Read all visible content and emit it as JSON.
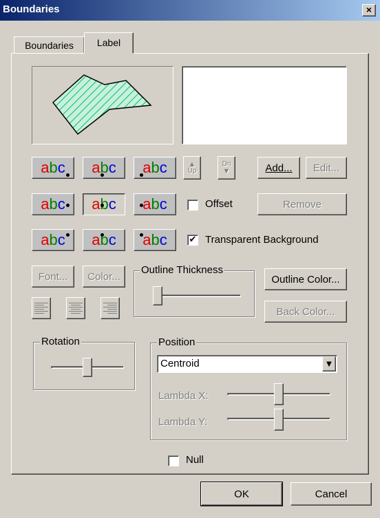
{
  "window": {
    "title": "Boundaries",
    "close_glyph": "×"
  },
  "tabs": [
    {
      "label": "Boundaries",
      "active": false
    },
    {
      "label": "Label",
      "active": true
    }
  ],
  "label_sample_text": "abc",
  "placement_buttons": [
    {
      "dot": "bottom-right",
      "pressed": false
    },
    {
      "dot": "bottom-center",
      "pressed": false
    },
    {
      "dot": "bottom-left",
      "pressed": false
    },
    {
      "dot": "right",
      "pressed": false
    },
    {
      "dot": "center",
      "pressed": true
    },
    {
      "dot": "left",
      "pressed": false
    },
    {
      "dot": "top-right",
      "pressed": false
    },
    {
      "dot": "top-center",
      "pressed": false
    },
    {
      "dot": "top-left",
      "pressed": false
    }
  ],
  "order_buttons": {
    "up_label": "Up",
    "down_label": "Dn",
    "up_icon": "arrow-up-icon",
    "down_icon": "arrow-down-icon"
  },
  "buttons": {
    "add": "Add...",
    "edit": "Edit...",
    "remove": "Remove",
    "font": "Font...",
    "color": "Color...",
    "outline_color": "Outline Color...",
    "back_color": "Back Color...",
    "ok": "OK",
    "cancel": "Cancel"
  },
  "checkboxes": {
    "offset": {
      "label": "Offset",
      "checked": false
    },
    "transparent_background": {
      "label": "Transparent Background",
      "checked": true
    },
    "null": {
      "label": "Null",
      "checked": false
    }
  },
  "check_glyph": "✔",
  "outline_thickness": {
    "title": "Outline Thickness",
    "level": 0.0
  },
  "rotation": {
    "title": "Rotation",
    "level": 0.5
  },
  "position": {
    "title": "Position",
    "selected": "Centroid",
    "dropdown_glyph": "▼",
    "lambda_x": {
      "label": "Lambda X:",
      "level": 0.5
    },
    "lambda_y": {
      "label": "Lambda Y:",
      "level": 0.5
    }
  },
  "alignment_icons": [
    "align-left-icon",
    "align-center-icon",
    "align-right-icon"
  ],
  "colors": {
    "hatch": "#00c070",
    "fill": "#c8f0dc",
    "title_start": "#0a246a",
    "title_end": "#a6caf0"
  }
}
